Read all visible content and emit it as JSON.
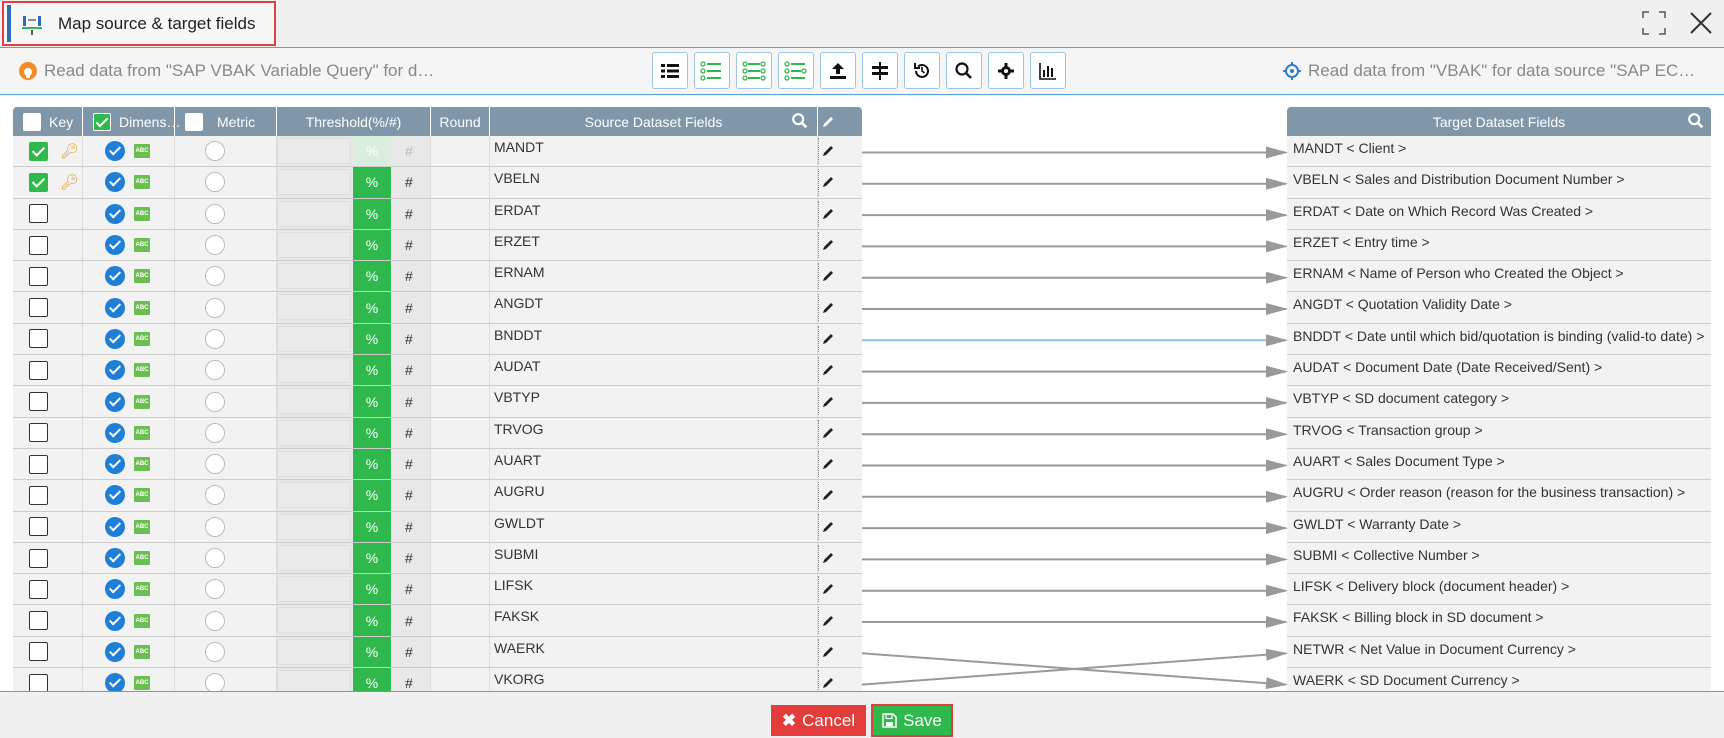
{
  "window": {
    "title": "Map source & target fields"
  },
  "toolbar": {
    "source_info": "Read data from \"SAP VBAK Variable Query\" for d…",
    "target_info": "Read data from \"VBAK\" for data source \"SAP EC…",
    "buttons": [
      "list-icon",
      "map-by-name-icon",
      "map-by-position-icon",
      "auto-map-icon",
      "upload-icon",
      "split-icon",
      "reset-icon",
      "search-icon",
      "settings-icon",
      "chart-icon"
    ]
  },
  "source_table": {
    "headers": {
      "key": "Key",
      "dimension": "Dimens…",
      "metric": "Metric",
      "threshold": "Threshold(%/#)",
      "round": "Round",
      "source": "Source Dataset Fields"
    },
    "threshold_pct": "%",
    "threshold_hash": "#",
    "rows": [
      {
        "field": "MANDT",
        "key": true,
        "dimension": true,
        "metric": false
      },
      {
        "field": "VBELN",
        "key": true,
        "dimension": true,
        "metric": false
      },
      {
        "field": "ERDAT",
        "key": false,
        "dimension": true,
        "metric": false
      },
      {
        "field": "ERZET",
        "key": false,
        "dimension": true,
        "metric": false
      },
      {
        "field": "ERNAM",
        "key": false,
        "dimension": true,
        "metric": false
      },
      {
        "field": "ANGDT",
        "key": false,
        "dimension": true,
        "metric": false
      },
      {
        "field": "BNDDT",
        "key": false,
        "dimension": true,
        "metric": false
      },
      {
        "field": "AUDAT",
        "key": false,
        "dimension": true,
        "metric": false
      },
      {
        "field": "VBTYP",
        "key": false,
        "dimension": true,
        "metric": false
      },
      {
        "field": "TRVOG",
        "key": false,
        "dimension": true,
        "metric": false
      },
      {
        "field": "AUART",
        "key": false,
        "dimension": true,
        "metric": false
      },
      {
        "field": "AUGRU",
        "key": false,
        "dimension": true,
        "metric": false
      },
      {
        "field": "GWLDT",
        "key": false,
        "dimension": true,
        "metric": false
      },
      {
        "field": "SUBMI",
        "key": false,
        "dimension": true,
        "metric": false
      },
      {
        "field": "LIFSK",
        "key": false,
        "dimension": true,
        "metric": false
      },
      {
        "field": "FAKSK",
        "key": false,
        "dimension": true,
        "metric": false
      },
      {
        "field": "WAERK",
        "key": false,
        "dimension": true,
        "metric": false
      },
      {
        "field": "VKORG",
        "key": false,
        "dimension": true,
        "metric": false
      }
    ]
  },
  "target_table": {
    "header": "Target Dataset Fields",
    "rows": [
      "MANDT < Client >",
      "VBELN < Sales and Distribution Document Number >",
      "ERDAT < Date on Which Record Was Created >",
      "ERZET < Entry time >",
      "ERNAM < Name of Person who Created the Object >",
      "ANGDT < Quotation Validity Date >",
      "BNDDT < Date until which bid/quotation is binding (valid-to date) >",
      "AUDAT < Document Date (Date Received/Sent) >",
      "VBTYP < SD document category >",
      "TRVOG < Transaction group >",
      "AUART < Sales Document Type >",
      "AUGRU < Order reason (reason for the business transaction) >",
      "GWLDT < Warranty Date >",
      "SUBMI < Collective Number >",
      "LIFSK < Delivery block (document header) >",
      "FAKSK < Billing block in SD document >",
      "NETWR < Net Value in Document Currency >",
      "WAERK < SD Document Currency >"
    ]
  },
  "mappings": [
    {
      "from": 0,
      "to": 0
    },
    {
      "from": 1,
      "to": 1
    },
    {
      "from": 2,
      "to": 2
    },
    {
      "from": 3,
      "to": 3
    },
    {
      "from": 4,
      "to": 4
    },
    {
      "from": 5,
      "to": 5
    },
    {
      "from": 6,
      "to": 6,
      "highlight": true
    },
    {
      "from": 7,
      "to": 7
    },
    {
      "from": 8,
      "to": 8
    },
    {
      "from": 9,
      "to": 9
    },
    {
      "from": 10,
      "to": 10
    },
    {
      "from": 11,
      "to": 11
    },
    {
      "from": 12,
      "to": 12
    },
    {
      "from": 13,
      "to": 13
    },
    {
      "from": 14,
      "to": 14
    },
    {
      "from": 15,
      "to": 15
    },
    {
      "from": 16,
      "to": 17
    },
    {
      "from": 17,
      "to": 16
    }
  ],
  "footer": {
    "cancel_label": "Cancel",
    "save_label": "Save"
  },
  "colors": {
    "accent_blue": "#1f7fd6",
    "green": "#2fb84c",
    "red": "#e43b3b",
    "header_gray": "#7f97a8"
  }
}
